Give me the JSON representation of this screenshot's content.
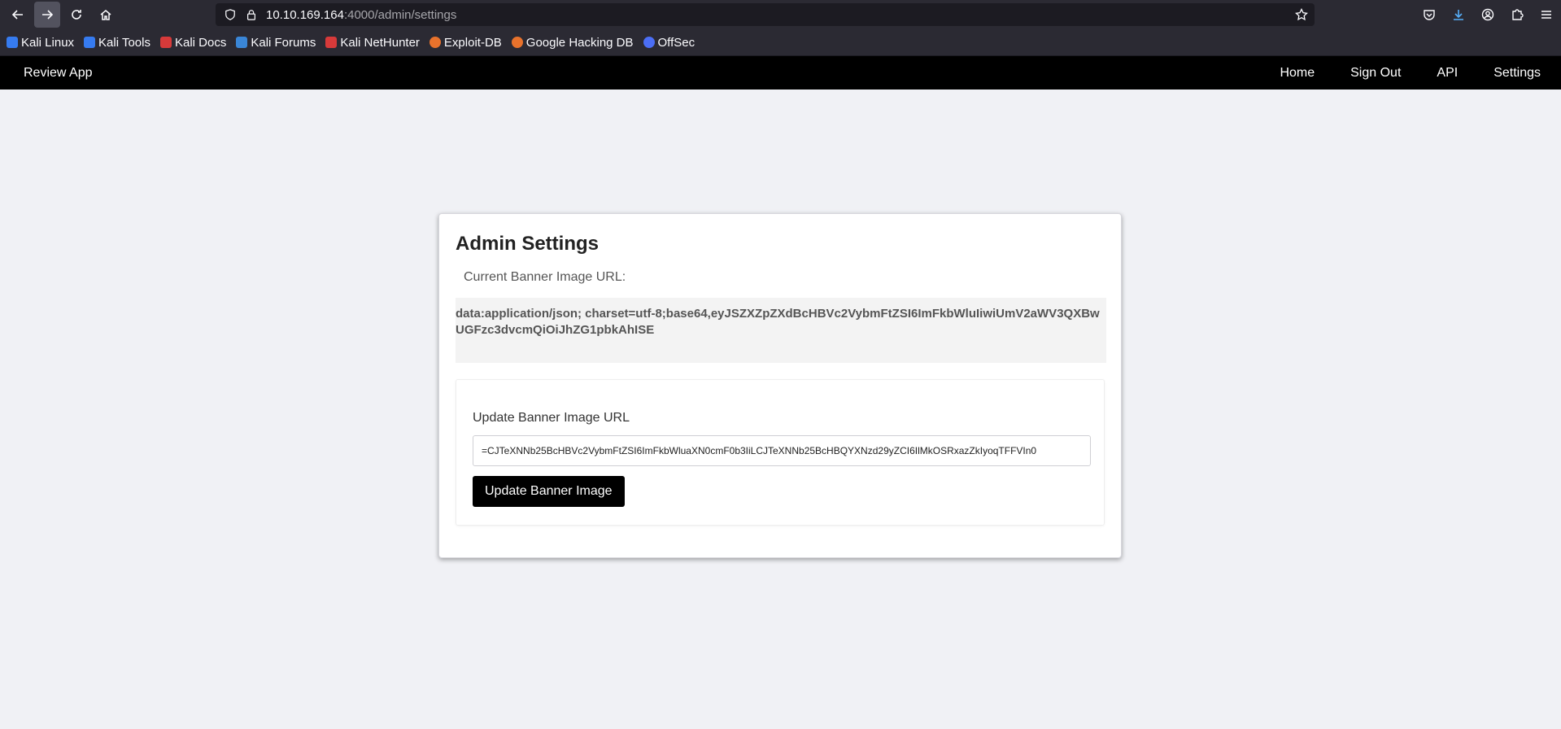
{
  "browser": {
    "url_host": "10.10.169.164",
    "url_path": ":4000/admin/settings",
    "bookmarks": [
      {
        "label": "Kali Linux",
        "color": "#367bf0"
      },
      {
        "label": "Kali Tools",
        "color": "#367bf0"
      },
      {
        "label": "Kali Docs",
        "color": "#d73a3a"
      },
      {
        "label": "Kali Forums",
        "color": "#3a86d7"
      },
      {
        "label": "Kali NetHunter",
        "color": "#d73a3a"
      },
      {
        "label": "Exploit-DB",
        "color": "#e8722c"
      },
      {
        "label": "Google Hacking DB",
        "color": "#e8722c"
      },
      {
        "label": "OffSec",
        "color": "#4b6ef5"
      }
    ]
  },
  "app": {
    "brand": "Review App",
    "nav": [
      "Home",
      "Sign Out",
      "API",
      "Settings"
    ]
  },
  "card": {
    "title": "Admin Settings",
    "current_label": "Current Banner Image URL:",
    "current_value": "data:application/json; charset=utf-8;base64,eyJSZXZpZXdBcHBVc2VybmFtZSI6ImFkbWluIiwiUmV2aWV3QXBwUGFzc3dvcmQiOiJhZG1pbkAhISE",
    "update_label": "Update Banner Image URL",
    "update_value": "CJTeXNNb25BcHBVc2VybmFtZSI6ImFkbWluaXN0cmF0b3IiLCJTeXNNb25BcHBQYXNzd29yZCI6IlMkOSRxazZkIyoqTFFVIn0=",
    "update_button": "Update Banner Image"
  },
  "icons": {
    "back": "arrow-left-icon",
    "forward": "arrow-right-icon",
    "reload": "reload-icon",
    "home": "home-icon",
    "shield": "shield-icon",
    "lock": "lock-icon",
    "star": "star-icon",
    "pocket": "pocket-icon",
    "download": "download-icon",
    "account": "account-icon",
    "extensions": "puzzle-icon",
    "menu": "hamburger-menu-icon"
  }
}
